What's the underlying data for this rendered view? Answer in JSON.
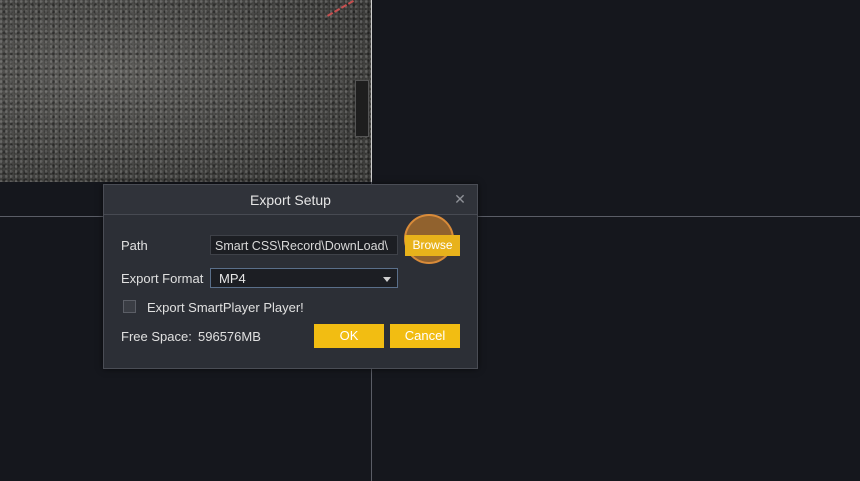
{
  "dialog": {
    "title": "Export Setup",
    "close_icon": "close-icon",
    "path_label": "Path",
    "path_value": "Smart CSS\\Record\\DownLoad\\",
    "browse_label": "Browse",
    "format_label": "Export Format",
    "format_value": "MP4",
    "export_player_label": "Export SmartPlayer Player!",
    "export_player_checked": false,
    "free_space_label": "Free Space:",
    "free_space_value": "596576MB",
    "ok_label": "OK",
    "cancel_label": "Cancel"
  },
  "colors": {
    "accent": "#f2bd12",
    "background": "#15171d",
    "dialog_bg": "#2c2f36"
  }
}
